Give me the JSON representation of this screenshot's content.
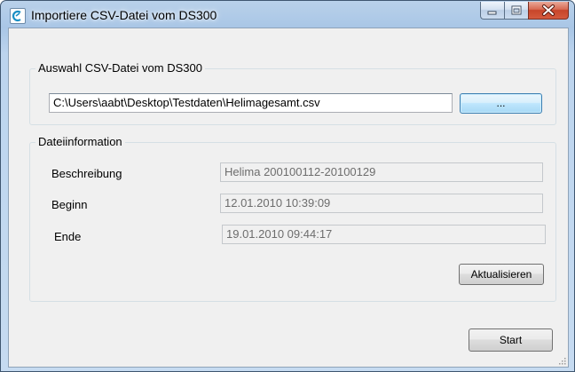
{
  "window": {
    "title": "Importiere CSV-Datei vom DS300",
    "icon": "app-logo-icon",
    "caption_buttons": [
      "minimize-icon",
      "maximize-icon",
      "close-icon"
    ]
  },
  "file_group": {
    "title": "Auswahl CSV-Datei vom DS300",
    "path_value": "C:\\Users\\aabt\\Desktop\\Testdaten\\Helimagesamt.csv",
    "browse_label": "..."
  },
  "info_group": {
    "title": "Dateiinformation",
    "rows": [
      {
        "label": "Beschreibung",
        "value": "Helima 200100112-20100129"
      },
      {
        "label": "Beginn",
        "value": "12.01.2010 10:39:09"
      },
      {
        "label": "Ende",
        "value": "19.01.2010 09:44:17"
      }
    ],
    "refresh_label": "Aktualisieren"
  },
  "footer": {
    "start_label": "Start"
  },
  "colors": {
    "accent_focus": "#3c7fb1",
    "close_button": "#c7452a",
    "titlebar": "#a9c6e6"
  }
}
